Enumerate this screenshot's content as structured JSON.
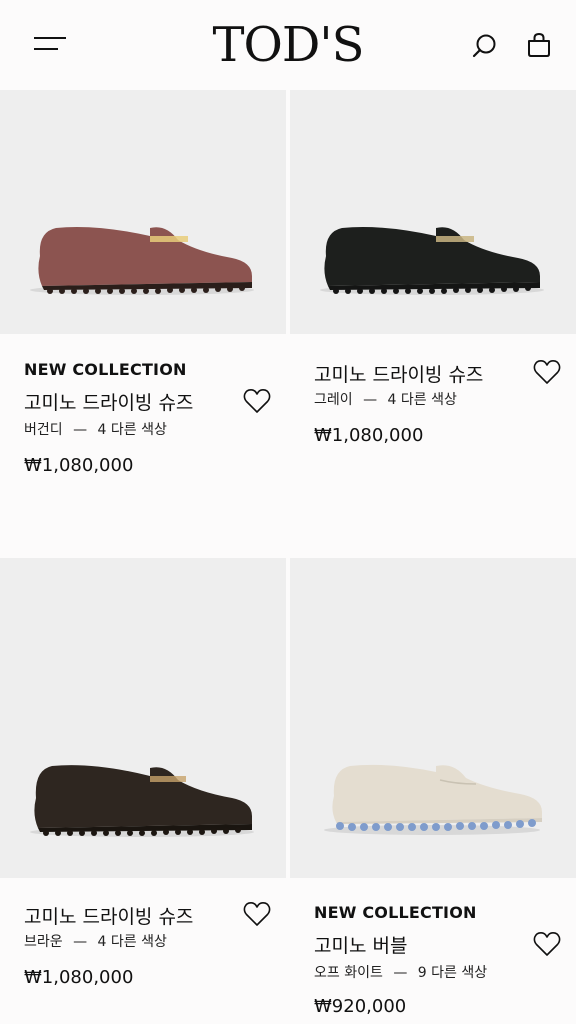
{
  "header": {
    "logo": "TOD'S",
    "icons": [
      "menu-icon",
      "search-icon",
      "shopping-bag-icon"
    ]
  },
  "products": [
    {
      "tag": "NEW COLLECTION",
      "name": "고미노 드라이빙 슈즈",
      "color": "버건디",
      "separator": "—",
      "more_colors": "4 다른 색상",
      "price": "₩1,080,000",
      "shoe_color": "#8c5450"
    },
    {
      "tag": "",
      "name": "고미노 드라이빙 슈즈",
      "color": "그레이",
      "separator": "—",
      "more_colors": "4 다른 색상",
      "price": "₩1,080,000",
      "shoe_color": "#1d1f1d"
    },
    {
      "tag": "",
      "name": "고미노 드라이빙 슈즈",
      "color": "브라운",
      "separator": "—",
      "more_colors": "4 다른 색상",
      "price": "₩1,080,000",
      "shoe_color": "#2e2620"
    },
    {
      "tag": "NEW COLLECTION",
      "name": "고미노 버블",
      "color": "오프 화이트",
      "separator": "—",
      "more_colors": "9 다른 색상",
      "price": "₩920,000",
      "shoe_color": "#e4ddd0",
      "sole_color": "#7f9ccc"
    }
  ]
}
